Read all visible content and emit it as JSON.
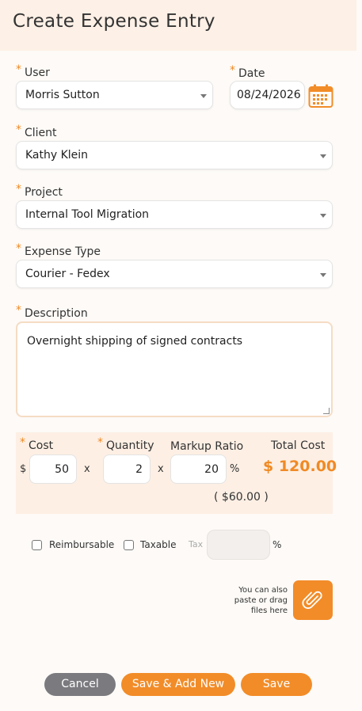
{
  "header": {
    "title": "Create Expense Entry"
  },
  "required_mark": "*",
  "form": {
    "user": {
      "label": "User",
      "value": "Morris Sutton"
    },
    "date": {
      "label": "Date",
      "value": "08/24/2026"
    },
    "client": {
      "label": "Client",
      "value": "Kathy Klein"
    },
    "project": {
      "label": "Project",
      "value": "Internal Tool Migration"
    },
    "expense_type": {
      "label": "Expense Type",
      "value": "Courier - Fedex"
    },
    "description": {
      "label": "Description",
      "value": "Overnight shipping of signed contracts"
    }
  },
  "cost": {
    "cost_label": "Cost",
    "currency_symbol": "$",
    "cost_value": "50",
    "times": "x",
    "quantity_label": "Quantity",
    "quantity_value": "2",
    "markup_label": "Markup Ratio",
    "markup_value": "20",
    "percent": "%",
    "total_label": "Total Cost",
    "total_value": "$ 120.00",
    "markup_amount": "( $60.00 )"
  },
  "options": {
    "reimbursable_label": "Reimbursable",
    "reimbursable_checked": false,
    "taxable_label": "Taxable",
    "taxable_checked": false,
    "tax_label": "Tax",
    "tax_value": "",
    "tax_percent": "%"
  },
  "attachment": {
    "hint_line1": "You can also",
    "hint_line2": "paste or drag",
    "hint_line3": "files here",
    "icon": "paperclip-icon"
  },
  "buttons": {
    "cancel": "Cancel",
    "save_add_new": "Save & Add New",
    "save": "Save"
  },
  "colors": {
    "accent": "#f28c28",
    "header_bg": "#fdf0e6",
    "cancel_bg": "#7a7a7f"
  }
}
